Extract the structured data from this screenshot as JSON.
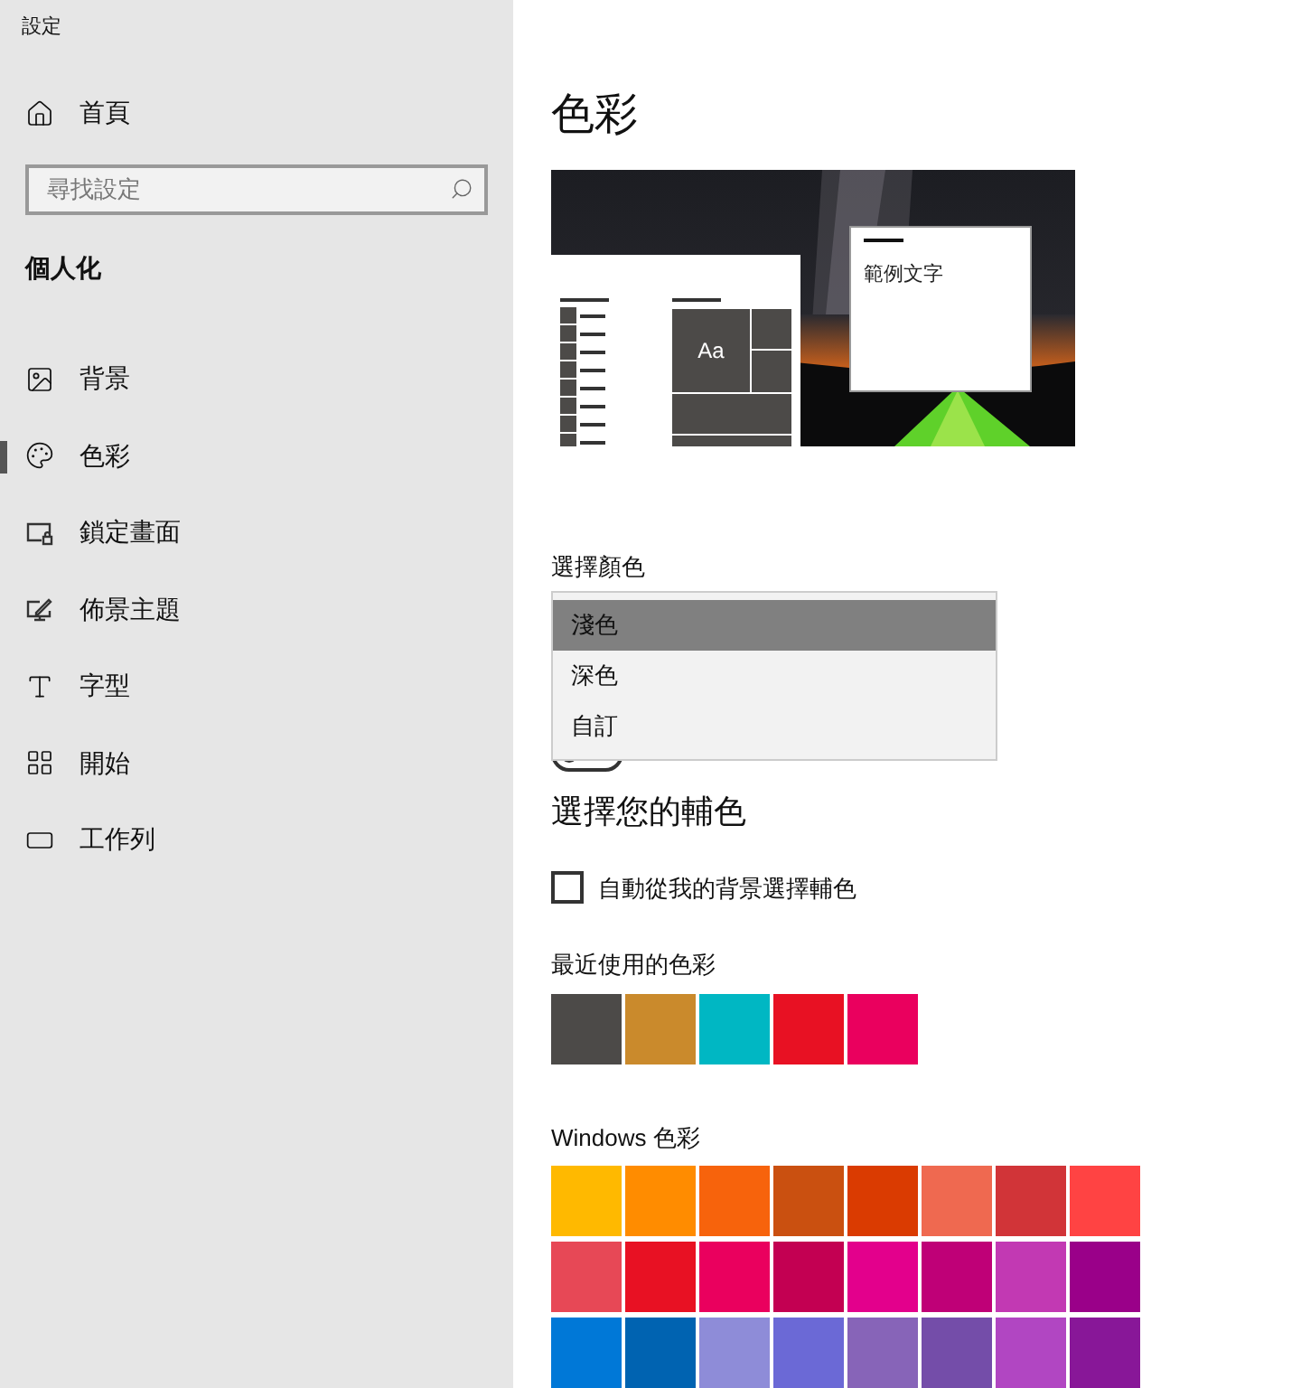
{
  "window": {
    "title": "設定"
  },
  "sidebar": {
    "home": "首頁",
    "search": {
      "placeholder": "尋找設定"
    },
    "section": "個人化",
    "items": [
      {
        "kind": "background",
        "label": "背景",
        "selected": false
      },
      {
        "kind": "colors",
        "label": "色彩",
        "selected": true
      },
      {
        "kind": "lockscreen",
        "label": "鎖定畫面",
        "selected": false
      },
      {
        "kind": "themes",
        "label": "佈景主題",
        "selected": false
      },
      {
        "kind": "fonts",
        "label": "字型",
        "selected": false
      },
      {
        "kind": "start",
        "label": "開始",
        "selected": false
      },
      {
        "kind": "taskbar",
        "label": "工作列",
        "selected": false
      }
    ]
  },
  "page": {
    "title": "色彩",
    "preview": {
      "tile_text": "Aa",
      "sample_text": "範例文字"
    },
    "choose_color": {
      "label": "選擇顏色",
      "options": [
        {
          "label": "淺色",
          "selected": true
        },
        {
          "label": "深色",
          "selected": false
        },
        {
          "label": "自訂",
          "selected": false
        }
      ]
    },
    "toggle": {
      "on": false
    },
    "accent_heading": "選擇您的輔色",
    "auto_accent": {
      "label": "自動從我的背景選擇輔色",
      "checked": false
    },
    "recent": {
      "label": "最近使用的色彩",
      "colors": [
        {
          "color": "#4c4a48"
        },
        {
          "color": "#ca8a2c"
        },
        {
          "color": "#00b7c3"
        },
        {
          "color": "#e81123"
        },
        {
          "color": "#ea005e"
        }
      ]
    },
    "windows_colors": {
      "label": "Windows 色彩",
      "colors": [
        {
          "color": "#ffb900"
        },
        {
          "color": "#ff8c00"
        },
        {
          "color": "#f7630c"
        },
        {
          "color": "#ca5010"
        },
        {
          "color": "#da3b01"
        },
        {
          "color": "#ef6950"
        },
        {
          "color": "#d13438"
        },
        {
          "color": "#ff4343"
        },
        {
          "color": "#e74856"
        },
        {
          "color": "#e81123"
        },
        {
          "color": "#ea005e"
        },
        {
          "color": "#c30052"
        },
        {
          "color": "#e3008c"
        },
        {
          "color": "#bf0077"
        },
        {
          "color": "#c239b3"
        },
        {
          "color": "#9a0089"
        },
        {
          "color": "#0078d7"
        },
        {
          "color": "#0063b1"
        },
        {
          "color": "#8e8cd8"
        },
        {
          "color": "#6b69d6"
        },
        {
          "color": "#8764b8"
        },
        {
          "color": "#744da9"
        },
        {
          "color": "#b146c2"
        },
        {
          "color": "#881798"
        }
      ]
    }
  }
}
